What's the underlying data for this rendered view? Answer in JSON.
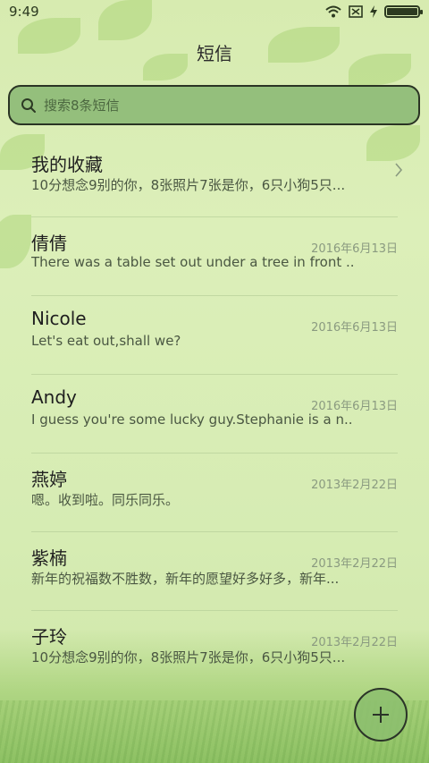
{
  "status": {
    "time": "9:49"
  },
  "title": "短信",
  "search": {
    "placeholder": "搜索8条短信"
  },
  "conversations": [
    {
      "name": "我的收藏",
      "preview": "10分想念9别的你，8张照片7张是你，6只小狗5只...",
      "date": ""
    },
    {
      "name": "倩倩",
      "preview": "There was a table set out under a tree in front ...",
      "date": "2016年6月13日"
    },
    {
      "name": "Nicole",
      "preview": "Let's eat out,shall we?",
      "date": "2016年6月13日"
    },
    {
      "name": "Andy",
      "preview": "I guess you're some lucky guy.Stephanie is a n...",
      "date": "2016年6月13日"
    },
    {
      "name": "燕婷",
      "preview": "嗯。收到啦。同乐同乐。",
      "date": "2013年2月22日"
    },
    {
      "name": "紫楠",
      "preview": "新年的祝福数不胜数，新年的愿望好多好多，新年...",
      "date": "2013年2月22日"
    },
    {
      "name": "子玲",
      "preview": "10分想念9别的你，8张照片7张是你，6只小狗5只...",
      "date": "2013年2月22日"
    }
  ],
  "colors": {
    "accent": "#94bf7c",
    "background": "#d7ebb0"
  },
  "icons": {
    "search": "search-icon",
    "fab": "plus-icon",
    "favorites": "chevron-right-icon"
  }
}
